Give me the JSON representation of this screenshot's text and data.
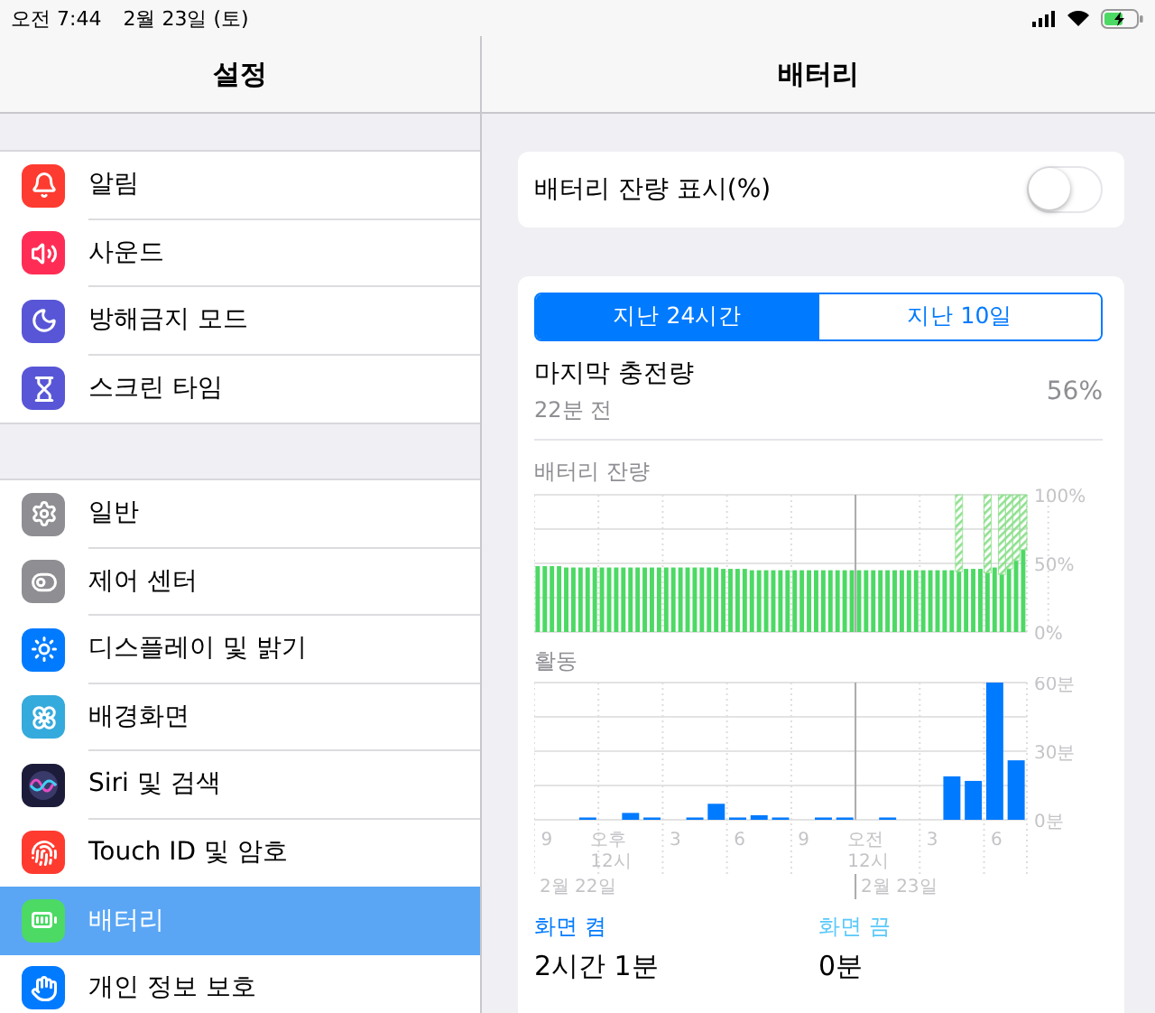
{
  "status_bar": {
    "time": "오전 7:44",
    "date": "2월 23일 (토)"
  },
  "sidebar": {
    "title": "설정",
    "groups": [
      [
        {
          "kind": "notifications",
          "label": "알림",
          "color": "#fe3b30",
          "selected": false
        },
        {
          "kind": "sound",
          "label": "사운드",
          "color": "#ff2d55",
          "selected": false
        },
        {
          "kind": "moon",
          "label": "방해금지 모드",
          "color": "#5856d6",
          "selected": false
        },
        {
          "kind": "hourglass",
          "label": "스크린 타임",
          "color": "#5856d6",
          "selected": false
        }
      ],
      [
        {
          "kind": "gear",
          "label": "일반",
          "color": "#8e8e93",
          "selected": false
        },
        {
          "kind": "toggles",
          "label": "제어 센터",
          "color": "#8e8e93",
          "selected": false
        },
        {
          "kind": "display",
          "label": "디스플레이 및 밝기",
          "color": "#007aff",
          "selected": false
        },
        {
          "kind": "flower",
          "label": "배경화면",
          "color": "#35aadc",
          "selected": false
        },
        {
          "kind": "siri",
          "label": "Siri 및 검색",
          "color": "#1c1c3a",
          "selected": false
        },
        {
          "kind": "fingerprint",
          "label": "Touch ID 및 암호",
          "color": "#ff3b30",
          "selected": false
        },
        {
          "kind": "battery",
          "label": "배터리",
          "color": "#4cd964",
          "selected": true
        },
        {
          "kind": "hand",
          "label": "개인 정보 보호",
          "color": "#007aff",
          "selected": false
        }
      ]
    ]
  },
  "detail": {
    "title": "배터리",
    "percentage_toggle": {
      "label": "배터리 잔량 표시(%)",
      "on": false
    },
    "tabs": [
      {
        "label": "지난 24시간",
        "selected": true
      },
      {
        "label": "지난 10일",
        "selected": false
      }
    ],
    "last_charge": {
      "label": "마지막 충전량",
      "time": "22분 전",
      "value": "56%"
    },
    "battery_chart": {
      "chart_data": {
        "type": "bar",
        "title": "배터리 잔량",
        "stacked": true,
        "ylim": [
          0,
          100
        ],
        "yticks": [
          {
            "value": 0,
            "label": "0%"
          },
          {
            "value": 50,
            "label": "50%"
          },
          {
            "value": 100,
            "label": "100%"
          }
        ],
        "series": [
          {
            "color": "#4cd964",
            "values": [
              48,
              48,
              48,
              48,
              47,
              47,
              47,
              47,
              47,
              47,
              47,
              47,
              47,
              47,
              47,
              47,
              47,
              47,
              47,
              47,
              47,
              47,
              47,
              47,
              47,
              47,
              46,
              46,
              46,
              46,
              45,
              45,
              45,
              45,
              45,
              45,
              45,
              45,
              45,
              45,
              45,
              45,
              45,
              45,
              45,
              45,
              45,
              45,
              45,
              45,
              45,
              45,
              45,
              45,
              45,
              45,
              45,
              45,
              45,
              44,
              46,
              46,
              46,
              43,
              47,
              42,
              46,
              52,
              60
            ]
          },
          {
            "color": "#8ee08e",
            "values": [
              null,
              null,
              null,
              null,
              null,
              null,
              null,
              null,
              null,
              null,
              null,
              null,
              null,
              null,
              null,
              null,
              null,
              null,
              null,
              null,
              null,
              null,
              null,
              null,
              null,
              null,
              null,
              null,
              null,
              null,
              null,
              null,
              null,
              null,
              null,
              null,
              null,
              null,
              null,
              null,
              null,
              null,
              null,
              null,
              null,
              null,
              null,
              null,
              null,
              null,
              null,
              null,
              null,
              null,
              null,
              null,
              null,
              null,
              null,
              56,
              null,
              null,
              null,
              57,
              null,
              58,
              54,
              48,
              40
            ]
          }
        ]
      }
    },
    "activity_chart": {
      "chart_data": {
        "type": "bar",
        "title": "활동",
        "ylim": [
          0,
          60
        ],
        "yticks": [
          {
            "value": 0,
            "label": "0분"
          },
          {
            "value": 30,
            "label": "30분"
          },
          {
            "value": 60,
            "label": "60분"
          }
        ],
        "categories": [
          "9",
          null,
          null,
          "오후 12시",
          null,
          null,
          "3",
          null,
          null,
          "6",
          null,
          null,
          "9",
          null,
          null,
          "오전 12시",
          null,
          null,
          "3",
          null,
          null,
          "6",
          null
        ],
        "annotations": [
          "2월 22일",
          "2월 23일"
        ],
        "values": [
          0,
          0,
          1,
          0,
          3,
          1,
          0,
          1,
          7,
          1,
          2,
          1,
          0,
          1,
          1,
          0,
          1,
          0,
          0,
          19,
          17,
          60,
          26
        ]
      }
    },
    "usage": [
      {
        "label": "화면 켬",
        "value": "2시간 1분",
        "color": "#007aff"
      },
      {
        "label": "화면 끔",
        "value": "0분",
        "color": "#5ac8fa"
      }
    ]
  }
}
